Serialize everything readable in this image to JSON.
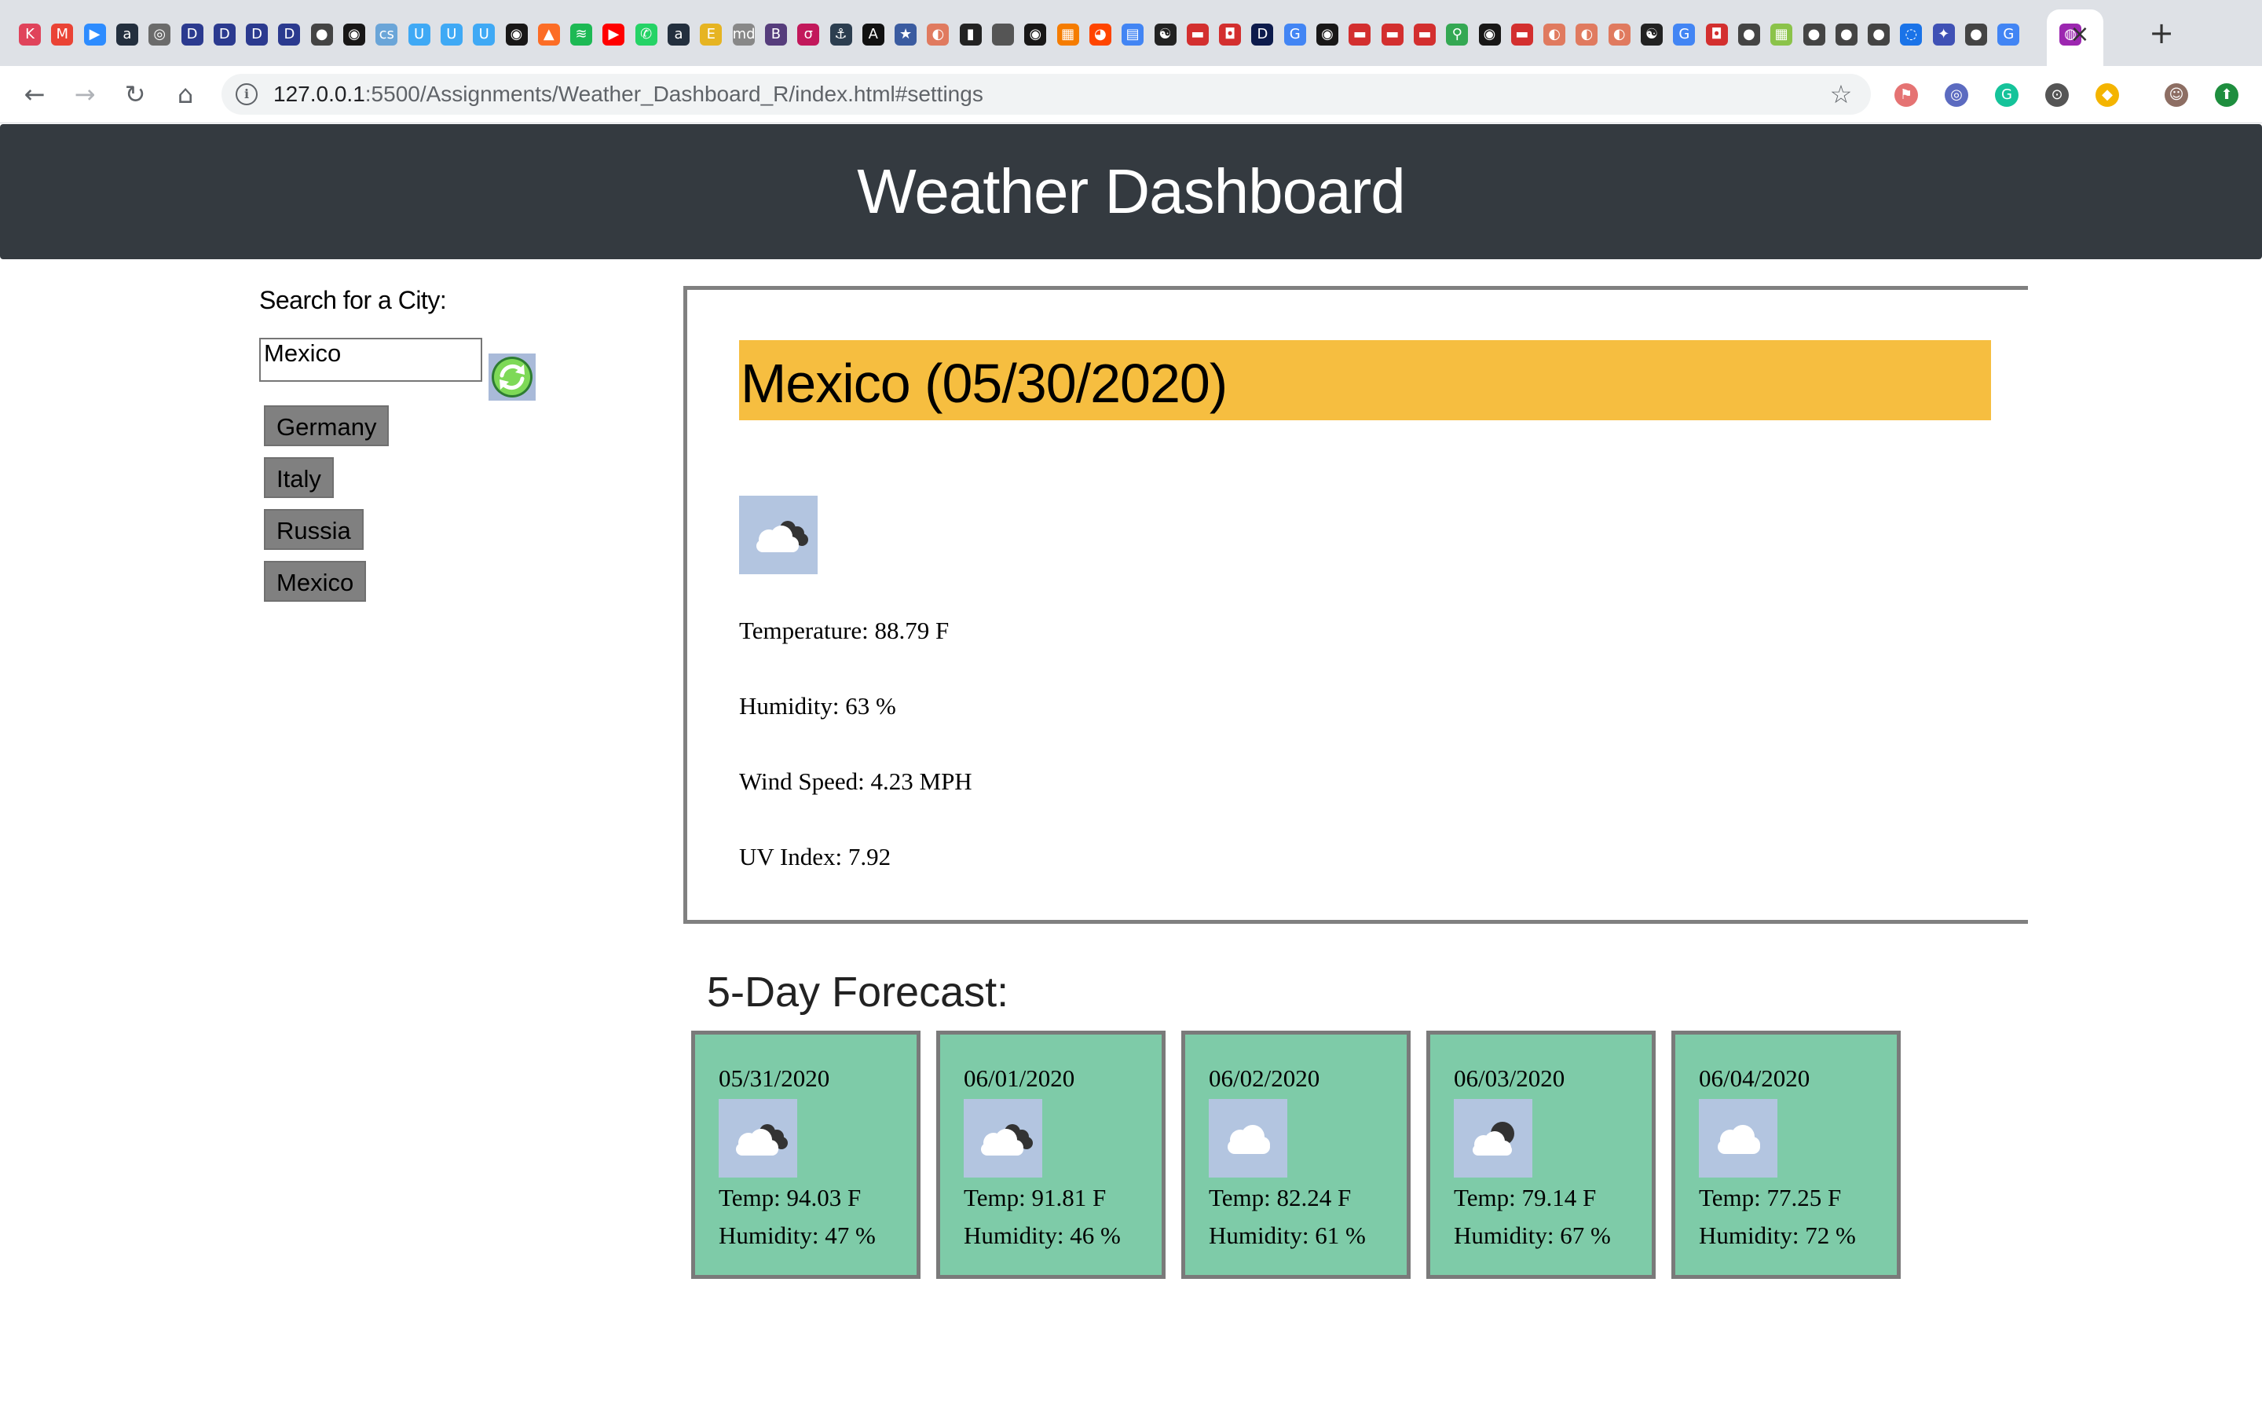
{
  "browser": {
    "url_host": "127.0.0.1",
    "url_path": ":5500/Assignments/Weather_Dashboard_R/index.html#settings",
    "active_tab_close": "×",
    "new_tab": "+",
    "tab_favicons": [
      {
        "icon": "K",
        "color": "#e0435b"
      },
      {
        "icon": "M",
        "color": "#ea4335"
      },
      {
        "icon": "▶",
        "color": "#2d8cff"
      },
      {
        "icon": "a",
        "color": "#232f3e"
      },
      {
        "icon": "◎",
        "color": "#6b6b6b"
      },
      {
        "icon": "D",
        "color": "#2b3a8f"
      },
      {
        "icon": "D",
        "color": "#2b3a8f"
      },
      {
        "icon": "D",
        "color": "#2b3a8f"
      },
      {
        "icon": "D",
        "color": "#2b3a8f"
      },
      {
        "icon": "●",
        "color": "#444"
      },
      {
        "icon": "◉",
        "color": "#181717"
      },
      {
        "icon": "cs",
        "color": "#6aa5d8"
      },
      {
        "icon": "U",
        "color": "#3fa9f5"
      },
      {
        "icon": "U",
        "color": "#3fa9f5"
      },
      {
        "icon": "U",
        "color": "#3fa9f5"
      },
      {
        "icon": "◉",
        "color": "#181717"
      },
      {
        "icon": "▲",
        "color": "#fc6d26"
      },
      {
        "icon": "≋",
        "color": "#1db954"
      },
      {
        "icon": "▶",
        "color": "#ff0000"
      },
      {
        "icon": "✆",
        "color": "#25d366"
      },
      {
        "icon": "a",
        "color": "#232f3e"
      },
      {
        "icon": "E",
        "color": "#e6b422"
      },
      {
        "icon": "md",
        "color": "#888"
      },
      {
        "icon": "B",
        "color": "#563d7c"
      },
      {
        "icon": "σ",
        "color": "#c2185b"
      },
      {
        "icon": "⚓",
        "color": "#2c3e50"
      },
      {
        "icon": "A",
        "color": "#111"
      },
      {
        "icon": "★",
        "color": "#3a5ba0"
      },
      {
        "icon": "◐",
        "color": "#e07a5f"
      },
      {
        "icon": "▮",
        "color": "#222"
      },
      {
        "icon": "",
        "color": "#555"
      },
      {
        "icon": "◉",
        "color": "#181717"
      },
      {
        "icon": "▦",
        "color": "#f57c00"
      },
      {
        "icon": "◕",
        "color": "#ff4500"
      },
      {
        "icon": "▤",
        "color": "#4285f4"
      },
      {
        "icon": "☯",
        "color": "#222"
      },
      {
        "icon": "▬",
        "color": "#d32f2f"
      },
      {
        "icon": "◘",
        "color": "#d32f2f"
      },
      {
        "icon": "D",
        "color": "#0d1b4c"
      },
      {
        "icon": "G",
        "color": "#4285f4"
      },
      {
        "icon": "◉",
        "color": "#181717"
      },
      {
        "icon": "▬",
        "color": "#d32f2f"
      },
      {
        "icon": "▬",
        "color": "#d32f2f"
      },
      {
        "icon": "▬",
        "color": "#d32f2f"
      },
      {
        "icon": "⚲",
        "color": "#34a853"
      },
      {
        "icon": "◉",
        "color": "#181717"
      },
      {
        "icon": "▬",
        "color": "#d32f2f"
      },
      {
        "icon": "◐",
        "color": "#e07a5f"
      },
      {
        "icon": "◐",
        "color": "#e07a5f"
      },
      {
        "icon": "◐",
        "color": "#e07a5f"
      },
      {
        "icon": "☯",
        "color": "#222"
      },
      {
        "icon": "G",
        "color": "#4285f4"
      },
      {
        "icon": "◘",
        "color": "#d32f2f"
      },
      {
        "icon": "●",
        "color": "#444"
      },
      {
        "icon": "▦",
        "color": "#8bc34a"
      },
      {
        "icon": "●",
        "color": "#444"
      },
      {
        "icon": "●",
        "color": "#444"
      },
      {
        "icon": "●",
        "color": "#444"
      },
      {
        "icon": "◌",
        "color": "#1a73e8"
      },
      {
        "icon": "✦",
        "color": "#3f51b5"
      },
      {
        "icon": "●",
        "color": "#444"
      },
      {
        "icon": "G",
        "color": "#4285f4"
      }
    ],
    "active_tab_favicon": {
      "icon": "◍",
      "color": "#9c27b0"
    },
    "extensions": [
      {
        "icon": "⚑",
        "color": "#e57373"
      },
      {
        "icon": "◎",
        "color": "#5c6bc0"
      },
      {
        "icon": "G",
        "color": "#15c39a"
      },
      {
        "icon": "⊙",
        "color": "#555"
      },
      {
        "icon": "◆",
        "color": "#f4b400"
      },
      {
        "icon": "☺",
        "color": "#8d6e63"
      },
      {
        "icon": "⬆",
        "color": "#1e8e3e"
      }
    ]
  },
  "page": {
    "title": "Weather Dashboard",
    "search_label": "Search for a City:",
    "search_value": "Mexico",
    "search_button_icon": "refresh-icon",
    "history": [
      "Germany",
      "Italy",
      "Russia",
      "Mexico"
    ]
  },
  "current": {
    "heading": "Mexico (05/30/2020)",
    "icon": "broken-clouds-icon",
    "temperature": "Temperature: 88.79 F",
    "humidity": "Humidity: 63 %",
    "wind": "Wind Speed: 4.23 MPH",
    "uv": "UV Index: 7.92"
  },
  "forecast": {
    "title": "5-Day Forecast:",
    "days": [
      {
        "date": "05/31/2020",
        "icon": "broken-clouds-icon",
        "temp": "Temp: 94.03 F",
        "humidity": "Humidity: 47 %"
      },
      {
        "date": "06/01/2020",
        "icon": "broken-clouds-icon",
        "temp": "Temp: 91.81 F",
        "humidity": "Humidity: 46 %"
      },
      {
        "date": "06/02/2020",
        "icon": "cloud-icon",
        "temp": "Temp: 82.24 F",
        "humidity": "Humidity: 61 %"
      },
      {
        "date": "06/03/2020",
        "icon": "scattered-clouds-icon",
        "temp": "Temp: 79.14 F",
        "humidity": "Humidity: 67 %"
      },
      {
        "date": "06/04/2020",
        "icon": "cloud-icon",
        "temp": "Temp: 77.25 F",
        "humidity": "Humidity: 72 %"
      }
    ]
  },
  "colors": {
    "header_bg": "#343a40",
    "title_bar": "#f6be40",
    "forecast_card": "#7ecba8",
    "history_button": "#808080",
    "icon_bg": "#b3c5e0"
  }
}
